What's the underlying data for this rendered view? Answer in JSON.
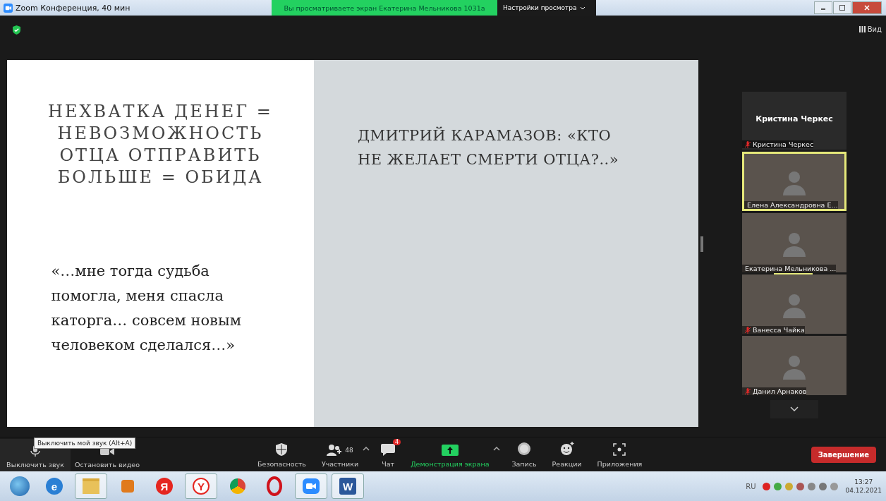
{
  "window": {
    "title": "Zoom Конференция, 40 мин"
  },
  "share_banner": {
    "text": "Вы просматриваете экран Екатерина Мельникова 1031а",
    "settings": "Настройки просмотра"
  },
  "view_button": "Вид",
  "slide": {
    "left_title": "НЕХВАТКА ДЕНЕГ = НЕВОЗМОЖНОСТЬ ОТЦА ОТПРАВИТЬ БОЛЬШЕ = ОБИДА",
    "left_quote": "«…мне тогда судьба помогла, меня спасла каторга… совсем новым человеком сделался…»",
    "right_title": "ДМИТРИЙ КАРАМАЗОВ: «КТО НЕ ЖЕЛАЕТ СМЕРТИ ОТЦА?..»"
  },
  "participants": [
    {
      "kind": "name-only",
      "heading": "Кристина Черкес",
      "name": "Кристина Черкес",
      "muted": true
    },
    {
      "kind": "video",
      "name": "Елена Александровна Е...",
      "muted": false,
      "speaking": true,
      "sharing": false
    },
    {
      "kind": "video",
      "name": "Екатерина Мельникова ...",
      "muted": false,
      "speaking": false,
      "sharing": true
    },
    {
      "kind": "video",
      "name": "Ванесса Чайка",
      "muted": true,
      "speaking": false,
      "sharing": false
    },
    {
      "kind": "video",
      "name": "Данил Арнаков",
      "muted": true,
      "speaking": false,
      "sharing": false
    }
  ],
  "tooltip": "Выключить мой звук (Alt+A)",
  "toolbar_left": [
    {
      "kind": "mic",
      "label": "Выключить звук"
    },
    {
      "kind": "camera",
      "label": "Остановить видео"
    }
  ],
  "toolbar_center": [
    {
      "kind": "shield",
      "label": "Безопасность",
      "caret": false,
      "active": false
    },
    {
      "kind": "people",
      "label": "Участники",
      "count": "48",
      "caret": true,
      "active": false
    },
    {
      "kind": "chat",
      "label": "Чат",
      "badge": "4",
      "caret": false,
      "active": false
    },
    {
      "kind": "share",
      "label": "Демонстрация экрана",
      "caret": true,
      "active": true
    },
    {
      "kind": "record",
      "label": "Запись",
      "caret": false,
      "active": false
    },
    {
      "kind": "reactions",
      "label": "Реакции",
      "caret": false,
      "active": false
    },
    {
      "kind": "apps",
      "label": "Приложения",
      "caret": false,
      "active": false
    }
  ],
  "end_button": "Завершение",
  "taskbar": {
    "apps": [
      {
        "kind": "start",
        "selected": false
      },
      {
        "kind": "ie",
        "glyph": "e",
        "selected": false
      },
      {
        "kind": "folder",
        "selected": true
      },
      {
        "kind": "media",
        "selected": false
      },
      {
        "kind": "yandex",
        "glyph": "Я",
        "selected": false
      },
      {
        "kind": "ybrowser",
        "glyph": "Y",
        "selected": true
      },
      {
        "kind": "chrome",
        "selected": false
      },
      {
        "kind": "opera",
        "selected": false
      },
      {
        "kind": "zoom",
        "selected": true
      },
      {
        "kind": "word",
        "glyph": "W",
        "selected": true
      }
    ],
    "language": "RU",
    "time": "13:27",
    "date": "04.12.2021"
  }
}
